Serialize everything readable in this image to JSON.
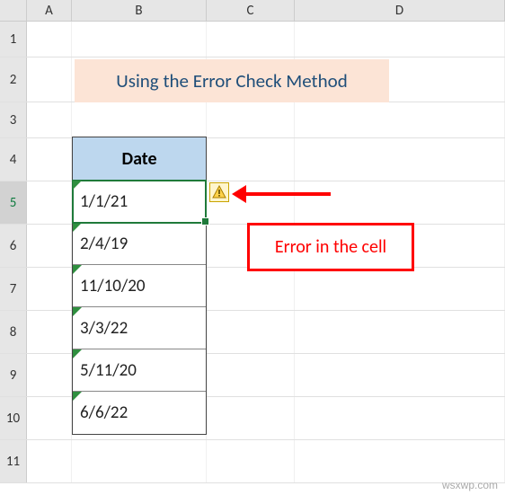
{
  "columns": [
    "A",
    "B",
    "C",
    "D"
  ],
  "rows": [
    "1",
    "2",
    "3",
    "4",
    "5",
    "6",
    "7",
    "8",
    "9",
    "10",
    "11"
  ],
  "title": "Using the Error Check Method",
  "table": {
    "header": "Date",
    "cells": [
      "1/1/21",
      "2/4/19",
      "11/10/20",
      "3/3/22",
      "5/11/20",
      "6/6/22"
    ]
  },
  "selected_row": "5",
  "callout_text": "Error in the cell",
  "error_icon": "warning-triangle",
  "watermark": "wsxwp.com",
  "colors": {
    "banner_bg": "#fce4d6",
    "banner_text": "#1f4e79",
    "header_bg": "#bdd7ee",
    "selection": "#1f7a3a",
    "error_triangle": "#2f8f3f",
    "callout": "#ff0000"
  },
  "chart_data": {
    "type": "table",
    "title": "Using the Error Check Method",
    "columns": [
      "Date"
    ],
    "rows": [
      [
        "1/1/21"
      ],
      [
        "2/4/19"
      ],
      [
        "11/10/20"
      ],
      [
        "3/3/22"
      ],
      [
        "5/11/20"
      ],
      [
        "6/6/22"
      ]
    ],
    "annotations": [
      "Error in the cell"
    ]
  }
}
